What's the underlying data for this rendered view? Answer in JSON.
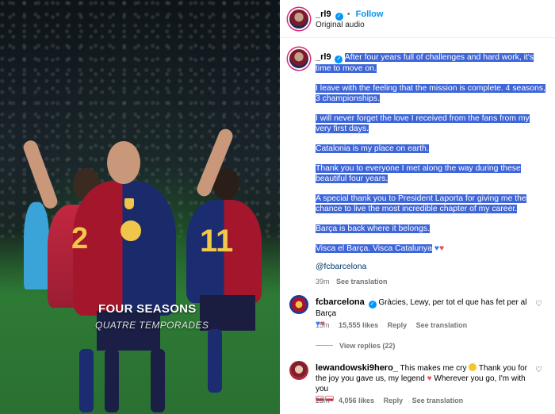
{
  "media": {
    "caption_title": "FOUR SEASONS",
    "caption_subtitle": "QUATRE TEMPORADES",
    "jersey_numbers": [
      "2",
      "11"
    ]
  },
  "post_header": {
    "username": "_rl9",
    "follow_label": "Follow",
    "separator": "•",
    "audio_label": "Original audio"
  },
  "caption": {
    "username": "_rl9",
    "paragraphs": [
      "After four years full of challenges and hard work, it's time to move on.",
      "I leave with the feeling that the mission is complete. 4 seasons, 3 championships.",
      "I will never forget the love I received from the fans from my very first days.",
      "Catalonia is my place on earth.",
      "Thank you to everyone I met along the way during these beautiful four years.",
      "A special thank you to President Laporta for giving me the chance to live the most incredible chapter of my career.",
      "Barça is back where it belongs.",
      "Visca el Barça. Visca Catalunya"
    ],
    "tag": "@fcbarcelona",
    "time": "39m",
    "see_translation": "See translation"
  },
  "comments": [
    {
      "username": "fcbarcelona",
      "text": "Gràcies, Lewy, per tot el que has fet per al Barça",
      "time": "15m",
      "likes": "15,555 likes",
      "reply_label": "Reply",
      "see_translation": "See translation",
      "view_replies": "View replies (22)"
    },
    {
      "username": "lewandowski9hero_",
      "text_part1": "This makes me cry",
      "text_part2": "Thank you for the joy you gave us, my legend",
      "text_part3": "Wherever you go, I'm with you",
      "time": "23m",
      "likes": "4,056 likes",
      "reply_label": "Reply",
      "see_translation": "See translation"
    }
  ],
  "icons": {
    "verified": "verified-badge-icon",
    "heart": "heart-icon",
    "like": "heart-outline-icon"
  },
  "colors": {
    "link_blue": "#0095f6",
    "highlight": "#3f66d8",
    "heart_red": "#ed4956",
    "meta_gray": "#737373"
  }
}
